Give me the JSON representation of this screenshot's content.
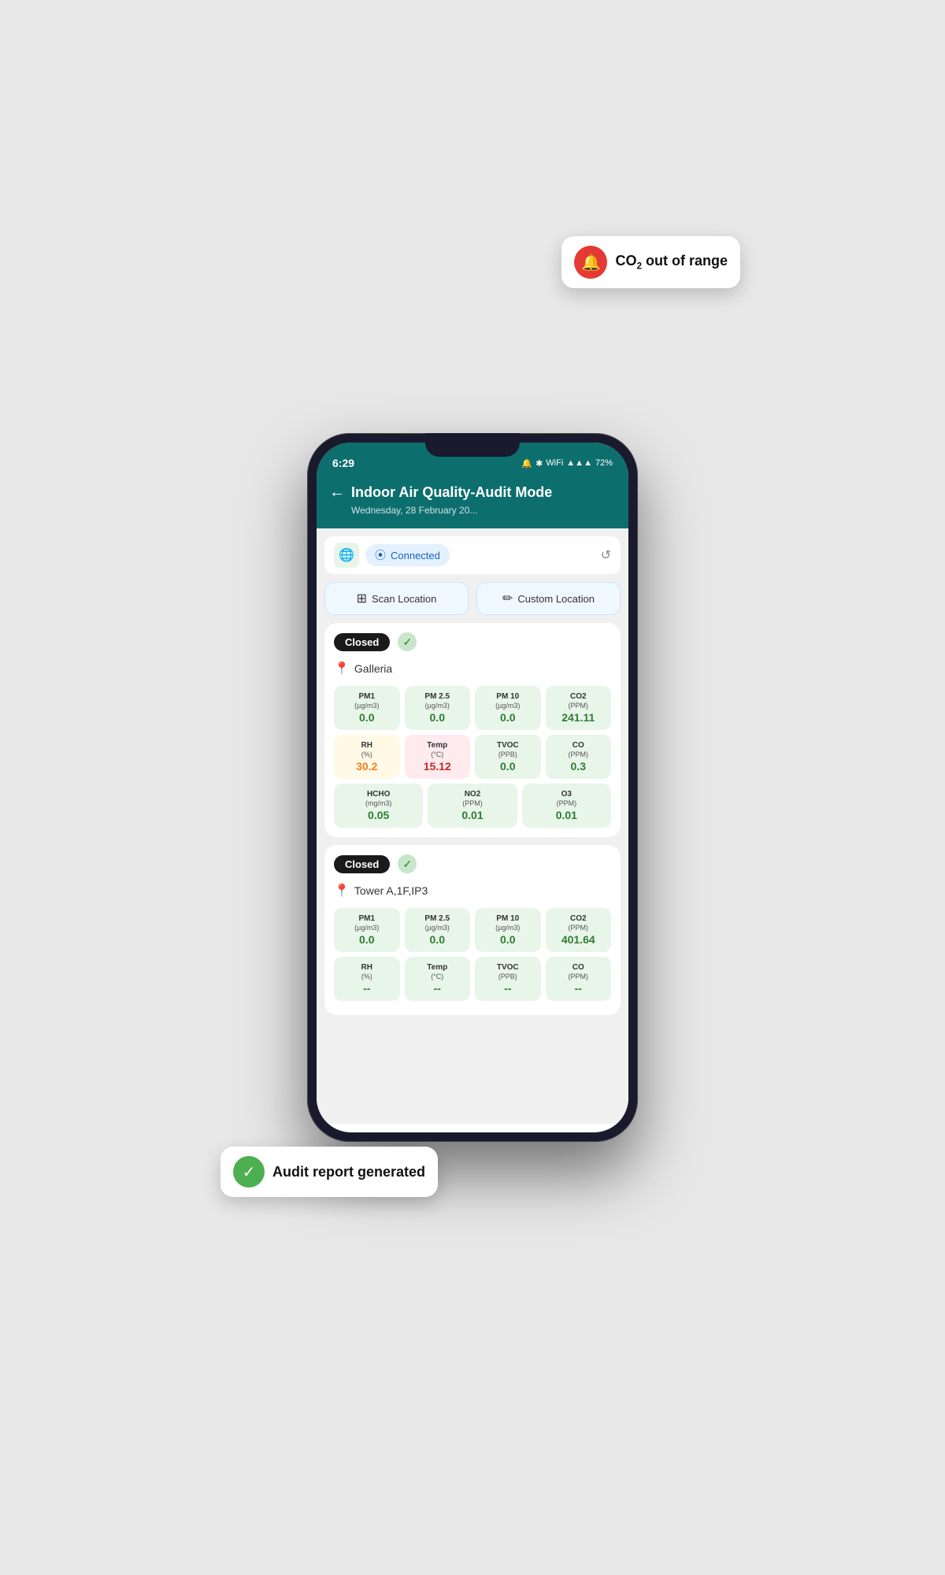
{
  "status_bar": {
    "time": "6:29",
    "icons": "▲ ✕ ⚡ ⊕ ▲▲▲ 72%"
  },
  "header": {
    "back_label": "←",
    "title": "Indoor Air Quality-Audit Mode",
    "date": "Wednesday, 28 February 20..."
  },
  "connection": {
    "bluetooth_label": "Connected",
    "refresh_icon": "↺"
  },
  "buttons": {
    "scan_location": "Scan Location",
    "custom_location": "Custom Location"
  },
  "tooltip_co2": {
    "text_part1": "CO",
    "text_part2": "2",
    "text_part3": " out of range"
  },
  "tooltip_audit": {
    "text": "Audit report generated"
  },
  "card1": {
    "status": "Closed",
    "location": "Galleria",
    "metrics": [
      {
        "label": "PM1",
        "unit": "(µg/m3)",
        "value": "0.0",
        "color": "green"
      },
      {
        "label": "PM 2.5",
        "unit": "(µg/m3)",
        "value": "0.0",
        "color": "green"
      },
      {
        "label": "PM 10",
        "unit": "(µg/m3)",
        "value": "0.0",
        "color": "green"
      },
      {
        "label": "CO2",
        "unit": "(PPM)",
        "value": "241.11",
        "color": "green"
      },
      {
        "label": "RH",
        "unit": "(%)",
        "value": "30.2",
        "color": "yellow"
      },
      {
        "label": "Temp",
        "unit": "(°C)",
        "value": "15.12",
        "color": "red"
      },
      {
        "label": "TVOC",
        "unit": "(PPB)",
        "value": "0.0",
        "color": "green"
      },
      {
        "label": "CO",
        "unit": "(PPM)",
        "value": "0.3",
        "color": "green"
      },
      {
        "label": "HCHO",
        "unit": "(mg/m3)",
        "value": "0.05",
        "color": "green"
      },
      {
        "label": "NO2",
        "unit": "(PPM)",
        "value": "0.01",
        "color": "green"
      },
      {
        "label": "O3",
        "unit": "(PPM)",
        "value": "0.01",
        "color": "green"
      }
    ]
  },
  "card2": {
    "status": "Closed",
    "location": "Tower A,1F,IP3",
    "metrics": [
      {
        "label": "PM1",
        "unit": "(µg/m3)",
        "value": "0.0",
        "color": "green"
      },
      {
        "label": "PM 2.5",
        "unit": "(µg/m3)",
        "value": "0.0",
        "color": "green"
      },
      {
        "label": "PM 10",
        "unit": "(µg/m3)",
        "value": "0.0",
        "color": "green"
      },
      {
        "label": "CO2",
        "unit": "(PPM)",
        "value": "401.64",
        "color": "green"
      },
      {
        "label": "RH",
        "unit": "(%)",
        "value": "--",
        "color": "green"
      },
      {
        "label": "Temp",
        "unit": "(°C)",
        "value": "--",
        "color": "green"
      },
      {
        "label": "TVOC",
        "unit": "(PPB)",
        "value": "--",
        "color": "green"
      },
      {
        "label": "CO",
        "unit": "(PPM)",
        "value": "--",
        "color": "green"
      }
    ]
  }
}
